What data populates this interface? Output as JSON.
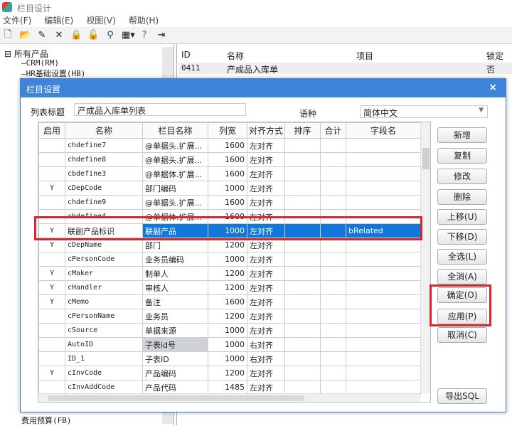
{
  "app": {
    "title": "栏目设计"
  },
  "menu": [
    "文件(F)",
    "编辑(E)",
    "视图(V)",
    "帮助(H)"
  ],
  "toolbar_icons": [
    "new-icon",
    "open-icon",
    "edit-icon",
    "delete-icon",
    "lock-icon",
    "unlock-icon",
    "find-icon",
    "view-icon",
    "help-icon",
    "exit-icon"
  ],
  "tree": {
    "root": "所有产品",
    "items": [
      "CRM(RM)",
      "HR基础设置(HB)",
      "费用预算(FB)"
    ]
  },
  "list": {
    "headers": [
      "ID",
      "名称",
      "项目",
      "锁定"
    ],
    "rows": [
      {
        "id": "0411",
        "name": "产成品入库单",
        "item": "",
        "locked": "否"
      }
    ]
  },
  "dialog": {
    "title": "栏目设置",
    "close": "×",
    "list_title_label": "列表标题",
    "list_title_value": "产成品入库单列表",
    "lang_label": "语种",
    "lang_value": "简体中文",
    "columns": [
      "启用",
      "名称",
      "栏目名称",
      "列宽",
      "对齐方式",
      "排序",
      "合计",
      "字段名"
    ],
    "rows": [
      [
        "",
        "chdefine7",
        "@单据头.扩展...",
        "1600",
        "左对齐",
        "",
        "",
        ""
      ],
      [
        "",
        "chdefine8",
        "@单据头.扩展...",
        "1600",
        "左对齐",
        "",
        "",
        ""
      ],
      [
        "",
        "cbdefine3",
        "@单据体.扩展...",
        "1600",
        "左对齐",
        "",
        "",
        ""
      ],
      [
        "Y",
        "cDepCode",
        "部门编码",
        "1000",
        "左对齐",
        "",
        "",
        ""
      ],
      [
        "",
        "chdefine9",
        "@单据头.扩展...",
        "1600",
        "左对齐",
        "",
        "",
        ""
      ],
      [
        "",
        "cbdefine4",
        "@单据体.扩展...",
        "1600",
        "左对齐",
        "",
        "",
        ""
      ],
      [
        "Y",
        "联副产品标识",
        "联副产品",
        "1000",
        "左对齐",
        "",
        "",
        "bRelated"
      ],
      [
        "Y",
        "cDepName",
        "部门",
        "1200",
        "左对齐",
        "",
        "",
        ""
      ],
      [
        "",
        "cPersonCode",
        "业务员编码",
        "1000",
        "左对齐",
        "",
        "",
        ""
      ],
      [
        "Y",
        "cMaker",
        "制单人",
        "1200",
        "左对齐",
        "",
        "",
        ""
      ],
      [
        "Y",
        "cHandler",
        "审核人",
        "1200",
        "左对齐",
        "",
        "",
        ""
      ],
      [
        "Y",
        "cMemo",
        "备注",
        "1600",
        "左对齐",
        "",
        "",
        ""
      ],
      [
        "",
        "cPersonName",
        "业务员",
        "1200",
        "左对齐",
        "",
        "",
        ""
      ],
      [
        "",
        "cSource",
        "单据来源",
        "1000",
        "左对齐",
        "",
        "",
        ""
      ],
      [
        "",
        "AutoID",
        "子表id号",
        "1000",
        "右对齐",
        "",
        "",
        ""
      ],
      [
        "",
        "ID_1",
        "子表ID",
        "1000",
        "右对齐",
        "",
        "",
        ""
      ],
      [
        "Y",
        "cInvCode",
        "产品编码",
        "1200",
        "左对齐",
        "",
        "",
        ""
      ],
      [
        "",
        "cInvAddCode",
        "产品代码",
        "1485",
        "左对齐",
        "",
        "",
        ""
      ]
    ],
    "selected_row": 6,
    "gray_row": 14,
    "buttons": {
      "add": "新增",
      "copy": "复制",
      "modify": "修改",
      "delete": "删除",
      "up": "上移(U)",
      "down": "下移(D)",
      "select_all": "全选(L)",
      "clear_all": "全消(A)",
      "ok": "确定(O)",
      "apply": "应用(P)",
      "cancel": "取消(C)",
      "export": "导出SQL"
    }
  },
  "colors": {
    "accent": "#3d85d8",
    "selection": "#1177d8",
    "highlight": "#d9262b"
  }
}
